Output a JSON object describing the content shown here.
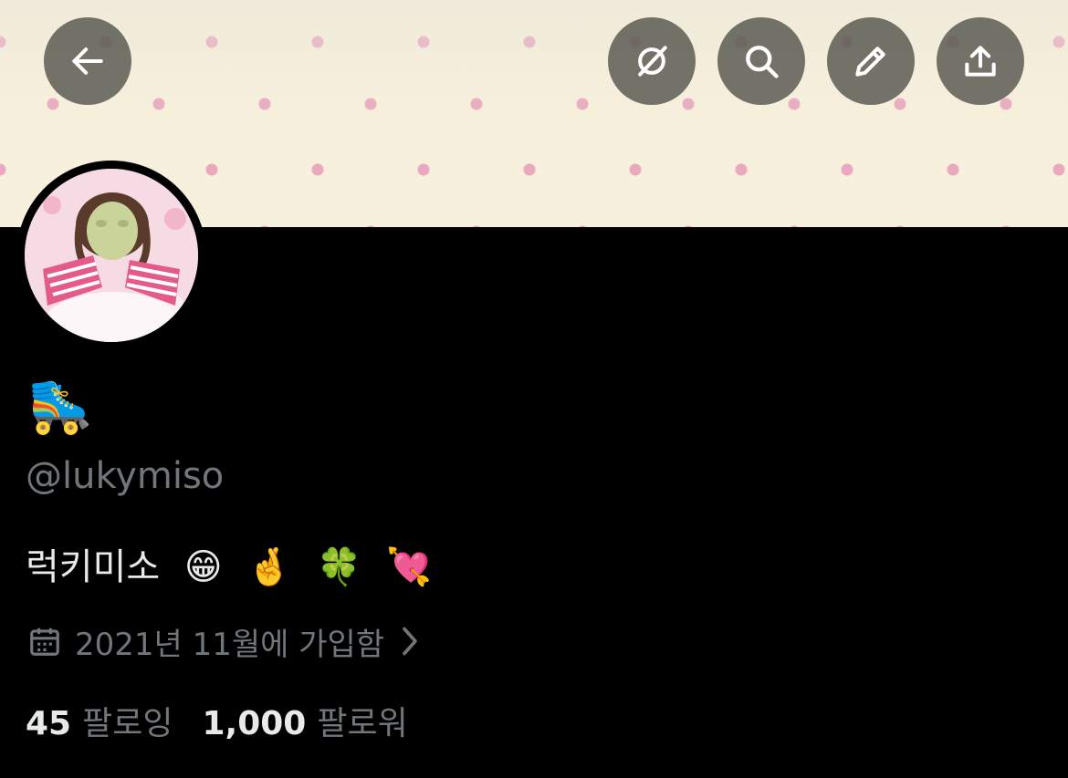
{
  "header": {
    "buttons": [
      {
        "name": "back-button",
        "icon": "arrow-left-icon"
      },
      {
        "name": "grok-button",
        "icon": "grok-icon"
      },
      {
        "name": "search-button",
        "icon": "search-icon"
      },
      {
        "name": "edit-button",
        "icon": "pencil-icon"
      },
      {
        "name": "share-button",
        "icon": "share-icon"
      }
    ]
  },
  "profile": {
    "display_name": "🛼",
    "handle": "@lukymiso",
    "bio_text": "럭키미소",
    "bio_emojis": [
      "😁",
      "🤞",
      "🍀",
      "💘"
    ],
    "joined": "2021년 11월에 가입함",
    "following_count": "45",
    "following_label": "팔로잉",
    "followers_count": "1,000",
    "followers_label": "팔로워"
  },
  "colors": {
    "background": "#000000",
    "primary_text": "#e7e9ea",
    "secondary_text": "#71767b",
    "button_bg": "#4e4e48",
    "banner_base": "#f7f0dc",
    "banner_dots": "#e9a9bf"
  }
}
